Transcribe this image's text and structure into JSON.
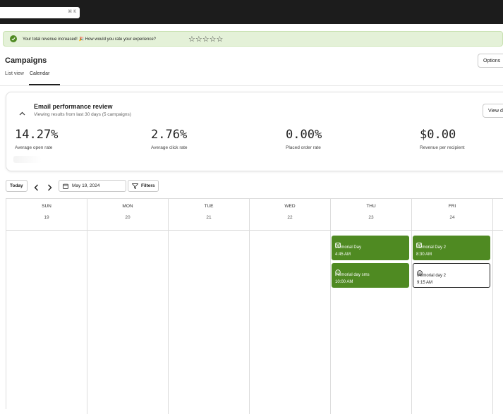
{
  "topbar": {
    "search_shortcut": "⌘ K"
  },
  "banner": {
    "message": "Your total revenue increased! 🎉 How would you rate your experience?",
    "stars": "☆☆☆☆☆"
  },
  "page": {
    "title": "Campaigns",
    "options_label": "Options",
    "tabs": [
      {
        "label": "List view",
        "active": false
      },
      {
        "label": "Calendar",
        "active": true
      }
    ]
  },
  "performance": {
    "title": "Email performance review",
    "subtitle": "Viewing results from last 30 days (5 campaigns)",
    "view_label": "View d",
    "metrics": [
      {
        "value": "14.27%",
        "label": "Average open rate"
      },
      {
        "value": "2.76%",
        "label": "Average click rate"
      },
      {
        "value": "0.00%",
        "label": "Placed order rate"
      },
      {
        "value": "$0.00",
        "label": "Revenue per recipient"
      }
    ]
  },
  "toolbar": {
    "today_label": "Today",
    "date_label": "May 19, 2024",
    "filters_label": "Filters"
  },
  "calendar": {
    "days": [
      {
        "name": "SUN",
        "num": "19"
      },
      {
        "name": "MON",
        "num": "20"
      },
      {
        "name": "TUE",
        "num": "21"
      },
      {
        "name": "WED",
        "num": "22"
      },
      {
        "name": "THU",
        "num": "23"
      },
      {
        "name": "FRI",
        "num": "24"
      }
    ],
    "events": [
      {
        "name": "Memorial Day",
        "time": "4:45 AM",
        "channel": "email",
        "style": "filled"
      },
      {
        "name": "memorial day sms",
        "time": "10:00 AM",
        "channel": "sms",
        "style": "filled"
      },
      {
        "name": "Memorial Day 2",
        "time": "8:30 AM",
        "channel": "email",
        "style": "filled"
      },
      {
        "name": "Memorial day 2",
        "time": "9:15 AM",
        "channel": "sms",
        "style": "outline"
      }
    ]
  },
  "colors": {
    "accent_green": "#4f8a22",
    "banner_bg": "#e4f1d8",
    "topbar": "#1c1c1c"
  }
}
